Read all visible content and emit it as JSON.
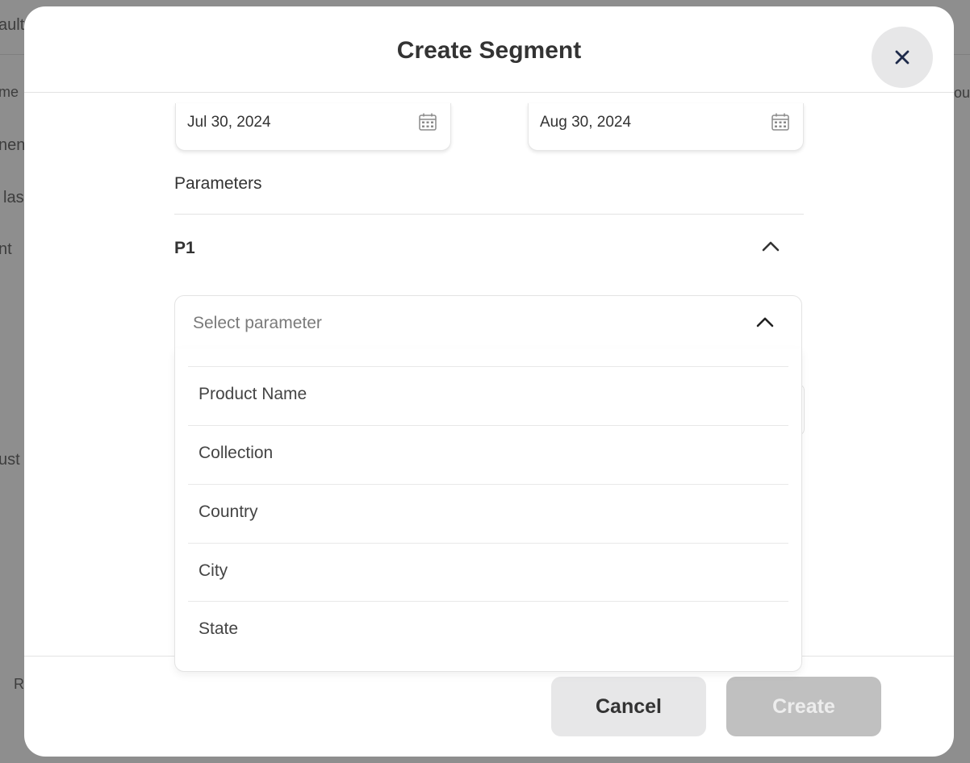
{
  "background": {
    "fragments": [
      "ault",
      "me",
      "nen",
      "las",
      "nt",
      "ust",
      "Re",
      "ou"
    ]
  },
  "modal": {
    "title": "Create Segment",
    "close_icon": "close-icon"
  },
  "date_range": {
    "start": "Jul 30, 2024",
    "end": "Aug 30, 2024",
    "icon": "calendar-icon"
  },
  "parameters": {
    "label": "Parameters",
    "group_label": "P1",
    "select": {
      "placeholder": "Select parameter",
      "options": [
        "Product Name",
        "Collection",
        "Country",
        "City",
        "State"
      ]
    }
  },
  "footer": {
    "cancel_label": "Cancel",
    "create_label": "Create"
  },
  "colors": {
    "overlay": "#8e8e8e",
    "modal_bg": "#ffffff",
    "cancel_bg": "#e7e7e8",
    "create_disabled_bg": "#c0c0c0"
  }
}
